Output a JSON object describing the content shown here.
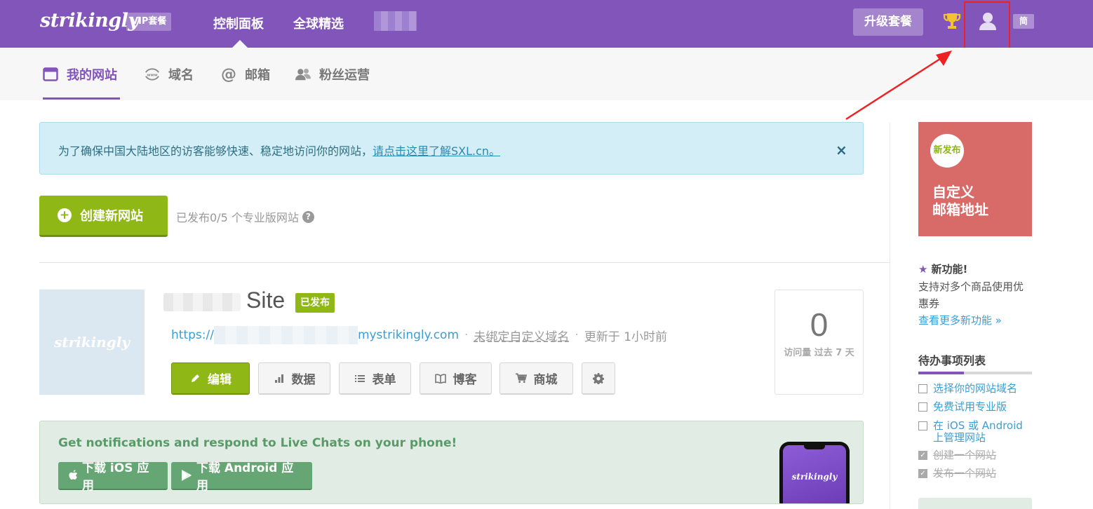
{
  "header": {
    "logo": "strikingly",
    "vip_badge": "VIP套餐",
    "nav": [
      "控制面板",
      "全球精选"
    ],
    "upgrade": "升级套餐",
    "lang": "简",
    "colors": {
      "bar": "#8155ba",
      "accent_green": "#8fb715",
      "annotation": "#ee2222"
    },
    "icons": [
      "trophy-icon",
      "user-icon"
    ]
  },
  "subnav": {
    "items": [
      {
        "label": "我的网站",
        "icon": "browser-window-icon",
        "active": true
      },
      {
        "label": "域名",
        "icon": "www-icon",
        "active": false
      },
      {
        "label": "邮箱",
        "icon": "at-sign-icon",
        "active": false
      },
      {
        "label": "粉丝运营",
        "icon": "users-icon",
        "active": false
      }
    ]
  },
  "info_banner": {
    "text": "为了确保中国大陆地区的访客能够快速、稳定地访问你的网站，",
    "link": "请点击这里了解SXL.cn。",
    "close": "×"
  },
  "create": {
    "label": "创建新网站",
    "count_text": "已发布0/5 个专业版网站"
  },
  "site": {
    "name": "Site",
    "status": "已发布",
    "thumb_logo": "strikingly",
    "url_prefix": "https://",
    "url_suffix": "mystrikingly.com",
    "domain_link": "未绑定自定义域名",
    "updated": "更新于 1小时前",
    "actions": [
      {
        "label": "编辑",
        "icon": "pencil-icon"
      },
      {
        "label": "数据",
        "icon": "bar-chart-icon"
      },
      {
        "label": "表单",
        "icon": "list-icon"
      },
      {
        "label": "博客",
        "icon": "book-icon"
      },
      {
        "label": "商城",
        "icon": "cart-icon"
      }
    ],
    "settings_icon": "gear-icon",
    "visits": "0",
    "visits_label": "访问量 过去 7 天"
  },
  "app_banner": {
    "text": "Get notifications and respond to Live Chats on your phone!",
    "ios": "下载 iOS 应用",
    "android": "下载 Android 应用",
    "phone_logo": "strikingly"
  },
  "sidebar": {
    "promo_badge": "新发布",
    "promo_title": "自定义\n邮箱地址",
    "new_title": "新功能!",
    "new_desc": "支持对多个商品使用优惠券",
    "new_link": "查看更多新功能 »",
    "todo_title": "待办事项列表",
    "todo_progress": 0.4,
    "todos": [
      {
        "label": "选择你的网站域名",
        "done": false
      },
      {
        "label": "免费试用专业版",
        "done": false
      },
      {
        "label": "在 iOS 或 Android 上管理网站",
        "done": false
      },
      {
        "label": "创建一个网站",
        "done": true
      },
      {
        "label": "发布一个网站",
        "done": true
      }
    ]
  }
}
